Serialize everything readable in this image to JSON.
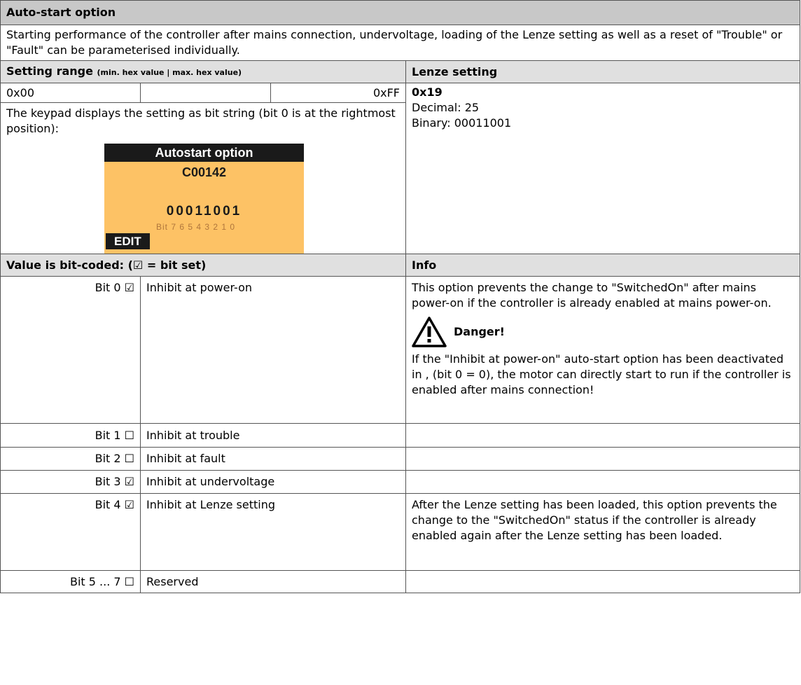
{
  "title": "Auto-start option",
  "description": "Starting performance of the controller after mains connection, undervoltage, loading of the Lenze setting as well as a reset of \"Trouble\" or \"Fault\" can be parameterised individually.",
  "setting_range": {
    "label": "Setting range",
    "sublabel": "(min. hex value | max. hex value)",
    "min": "0x00",
    "max": "0xFF"
  },
  "lenze_setting": {
    "label": "Lenze setting",
    "hex": "0x19",
    "decimal": "Decimal: 25",
    "binary": "Binary: 00011001"
  },
  "keypad_note": "The keypad displays the setting as bit string (bit 0 is at the rightmost position):",
  "keypad": {
    "title": "Autostart option",
    "code": "C00142",
    "bits": "00011001",
    "legend": "Bit 7 6 5 4 3 2 1 0",
    "edit": "EDIT"
  },
  "bitcoded_label": "Value is bit-coded:  (☑ = bit set)",
  "info_label": "Info",
  "danger": {
    "label": "Danger!",
    "text": "If the \"Inhibit at power-on\" auto-start option has been deactivated in , (bit 0 = 0), the motor can directly start to run if the controller is enabled after mains connection!"
  },
  "bits": [
    {
      "bit": "Bit 0 ☑",
      "name": "Inhibit at power-on",
      "info": "This option prevents the change to \"SwitchedOn\" after mains power-on if the controller is already enabled at mains power-on."
    },
    {
      "bit": "Bit 1 ☐",
      "name": "Inhibit at trouble",
      "info": ""
    },
    {
      "bit": "Bit 2 ☐",
      "name": "Inhibit at fault",
      "info": ""
    },
    {
      "bit": "Bit 3 ☑",
      "name": "Inhibit at undervoltage",
      "info": ""
    },
    {
      "bit": "Bit 4 ☑",
      "name": "Inhibit at Lenze setting",
      "info": "After the Lenze setting has been loaded, this option prevents the change to the \"SwitchedOn\" status if the controller is already enabled again after the Lenze setting has been loaded."
    },
    {
      "bit": "Bit 5 ... 7 ☐",
      "name": "Reserved",
      "info": ""
    }
  ]
}
